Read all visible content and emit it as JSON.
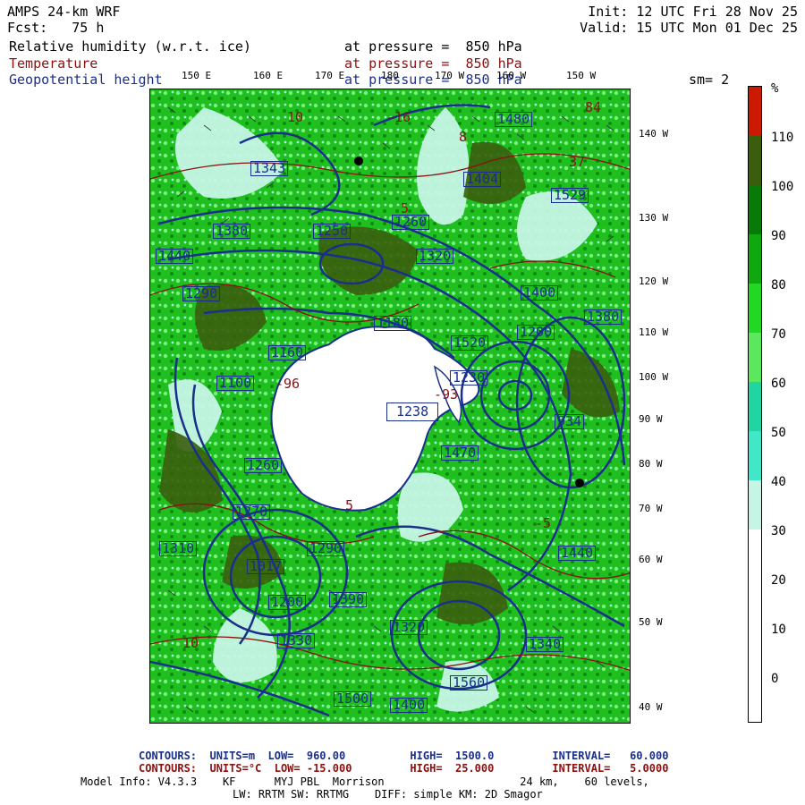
{
  "header": {
    "model": "AMPS 24-km WRF",
    "fcst": "Fcst:   75 h",
    "init": "Init: 12 UTC Fri 28 Nov 25",
    "valid": "Valid: 15 UTC Mon 01 Dec 25"
  },
  "fields": [
    {
      "name": "Relative humidity (w.r.t. ice)",
      "pressure": "at pressure =  850 hPa",
      "color": "#000000"
    },
    {
      "name": "Temperature",
      "pressure": "at pressure =  850 hPa",
      "color": "#8b1010"
    },
    {
      "name": "Geopotential height",
      "pressure": "at pressure =  850 hPa",
      "color": "#1a2f8c"
    }
  ],
  "smoothing": "sm= 2",
  "lon_labels": [
    "150 E",
    "160 E",
    "170 E",
    "180",
    "170 W",
    "160 W",
    "150 W"
  ],
  "lat_labels": [
    "140 W",
    "130 W",
    "120 W",
    "110 W",
    "100 W",
    "90 W",
    "80 W",
    "70 W",
    "60 W",
    "50 W",
    "40 W"
  ],
  "height_labels": [
    "1480",
    "1404",
    "1529",
    "1343",
    "1380",
    "1320",
    "1290",
    "1250",
    "1440",
    "1400",
    "1380",
    "1260",
    "1160",
    "1100",
    "1230",
    "1238",
    "1200",
    "1180",
    "934",
    "1260",
    "1270",
    "1310",
    "1440",
    "1017",
    "1290",
    "1200",
    "1390",
    "1320",
    "1330",
    "1340",
    "1560",
    "1500",
    "1400",
    "1470",
    "1520"
  ],
  "temp_labels": [
    "10",
    "-16",
    "5",
    "8",
    "-96",
    "-93",
    "84",
    "37",
    "5",
    "10",
    "-5"
  ],
  "colorbar": {
    "unit": "%",
    "ticks": [
      "110",
      "100",
      "90",
      "80",
      "70",
      "60",
      "50",
      "40",
      "30",
      "20",
      "10",
      "0"
    ],
    "colors": [
      "#cc1a00",
      "#3a5e0e",
      "#087a08",
      "#0fa80f",
      "#22d822",
      "#5ce85c",
      "#1fd6a0",
      "#40e8c8",
      "#c6f5e6",
      "#ffffff",
      "#ffffff",
      "#ffffff",
      "#ffffff"
    ]
  },
  "footer": {
    "contour1": "CONTOURS:  UNITS=m  LOW=  960.00          HIGH=  1500.0         INTERVAL=   60.000",
    "contour2": "CONTOURS:  UNITS=°C  LOW= -15.000         HIGH=  25.000         INTERVAL=   5.0000",
    "model_info": "Model Info: V4.3.3    KF      MYJ PBL  Morrison                     24 km,    60 levels,",
    "physics": "LW: RRTM SW: RRTMG    DIFF: simple KM: 2D Smagor"
  }
}
